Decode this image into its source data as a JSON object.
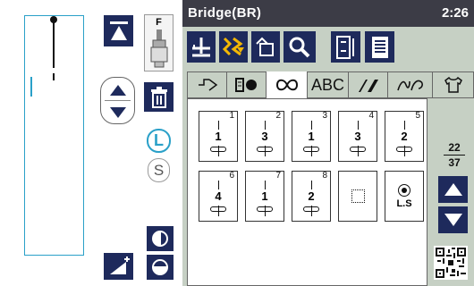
{
  "header": {
    "title": "Bridge(BR)",
    "clock": "2:26"
  },
  "foot": {
    "label": "F"
  },
  "size": {
    "large": "L",
    "small": "S"
  },
  "tabs": [
    {
      "id": "utility",
      "icon": "utility-stitch-icon"
    },
    {
      "id": "applique",
      "icon": "applique-stitch-icon"
    },
    {
      "id": "buttonhole",
      "icon": "buttonhole-icon",
      "active": true
    },
    {
      "id": "letters",
      "label": "ABC"
    },
    {
      "id": "satin",
      "icon": "satin-stitch-icon"
    },
    {
      "id": "decorative",
      "icon": "decorative-stitch-icon"
    },
    {
      "id": "motif",
      "icon": "shirt-icon"
    }
  ],
  "stitches": [
    {
      "num": "1",
      "width": "1"
    },
    {
      "num": "2",
      "width": "3"
    },
    {
      "num": "3",
      "width": "1"
    },
    {
      "num": "4",
      "width": "3"
    },
    {
      "num": "5",
      "width": "2"
    },
    {
      "num": "6",
      "width": "4"
    },
    {
      "num": "7",
      "width": "1"
    },
    {
      "num": "8",
      "width": "2"
    },
    {
      "num": "",
      "width": ""
    },
    {
      "num": "",
      "width": "L.S"
    }
  ],
  "page": {
    "current": "22",
    "total": "37"
  },
  "colors": {
    "panel_bg": "#c6d0c4",
    "header_bg": "#3c3c46",
    "nav_bg": "#1e2a5c",
    "guide": "#2aa0c8",
    "tab_active": "#ffffff"
  }
}
